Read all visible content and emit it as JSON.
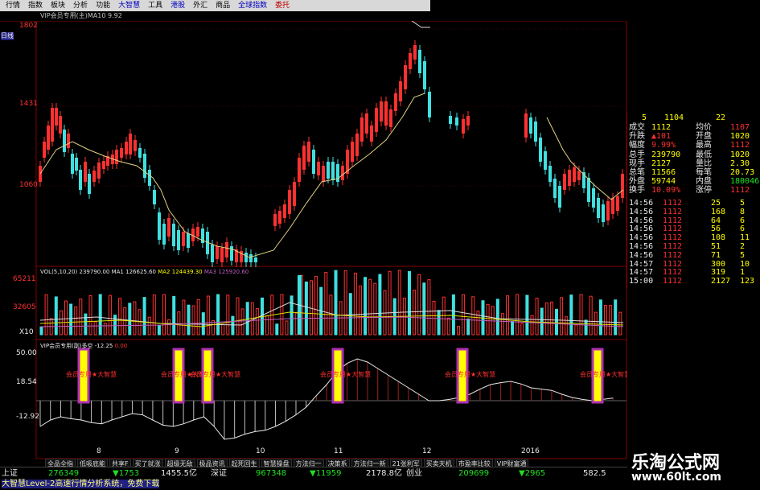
{
  "menu": {
    "items": [
      {
        "label": "行情",
        "color": "black"
      },
      {
        "label": "指数",
        "color": "black"
      },
      {
        "label": "板块",
        "color": "black"
      },
      {
        "label": "分析",
        "color": "black"
      },
      {
        "label": "功能",
        "color": "black"
      },
      {
        "label": "大智慧",
        "color": "blue"
      },
      {
        "label": "工具",
        "color": "black"
      },
      {
        "label": "港股",
        "color": "blue"
      },
      {
        "label": "外汇",
        "color": "black"
      },
      {
        "label": "商品",
        "color": "black"
      },
      {
        "label": "全球指数",
        "color": "blue"
      },
      {
        "label": "委托",
        "color": "red"
      }
    ]
  },
  "chart_header": {
    "indicator_title": "VIP会员专用(主)MA10 9.92",
    "period": "日线"
  },
  "price_axis": {
    "labels": [
      "1802",
      "1431",
      "1060"
    ]
  },
  "volume_header": {
    "vol": "VOL(5,10,20)",
    "vol_value": "239790.00",
    "ma1_label": "MA1",
    "ma1": "126625.60",
    "ma2_label": "MA2",
    "ma2": "124439.30",
    "ma3_label": "MA3",
    "ma3": "125920.60"
  },
  "volume_axis": {
    "labels": [
      "65211",
      "32605"
    ],
    "unit": "X10"
  },
  "osc_header": {
    "title": "VIP会员专用(副)多空",
    "value": "-12.25",
    "value2": "0.00"
  },
  "osc_axis": {
    "labels": [
      "50.00",
      "18.54",
      "-12.92"
    ]
  },
  "x_axis": {
    "labels": [
      "8",
      "9",
      "10",
      "11",
      "12",
      "2016"
    ]
  },
  "signal_label": "会员专用",
  "signal_star": "★",
  "signal_text2": "大智慧",
  "quote": {
    "code": "5",
    "price": "1104",
    "num": "22",
    "fields": [
      {
        "k1": "成交",
        "v1": "1112",
        "k2": "均价",
        "v2": "1107"
      },
      {
        "k1": "升跌",
        "v1": "▲101",
        "k2": "开盘",
        "v2": "1020"
      },
      {
        "k1": "幅度",
        "v1": "9.99%",
        "k2": "最高",
        "v2": "1112"
      },
      {
        "k1": "总手",
        "v1": "239790",
        "k2": "最低",
        "v2": "1020"
      },
      {
        "k1": "现手",
        "v1": "2127",
        "k2": "量比",
        "v2": "2.30"
      },
      {
        "k1": "总笔",
        "v1": "11566",
        "k2": "每笔",
        "v2": "20.73"
      },
      {
        "k1": "外盘",
        "v1": "59744",
        "k2": "内盘",
        "v2": "180046"
      },
      {
        "k1": "换手",
        "v1": "10.09%",
        "k2": "涨停",
        "v2": "1112"
      }
    ],
    "ticks": [
      {
        "t": "14:56",
        "p": "1112",
        "v": "25",
        "n": "5"
      },
      {
        "t": "14:56",
        "p": "1112",
        "v": "168",
        "n": "8"
      },
      {
        "t": "14:56",
        "p": "1112",
        "v": "64",
        "n": "6"
      },
      {
        "t": "14:56",
        "p": "1112",
        "v": "56",
        "n": "6"
      },
      {
        "t": "14:56",
        "p": "1112",
        "v": "108",
        "n": "11"
      },
      {
        "t": "14:56",
        "p": "1112",
        "v": "51",
        "n": "2"
      },
      {
        "t": "14:56",
        "p": "1112",
        "v": "71",
        "n": "5"
      },
      {
        "t": "14:57",
        "p": "1112",
        "v": "300",
        "n": "10"
      },
      {
        "t": "14:57",
        "p": "1112",
        "v": "319",
        "n": "1"
      },
      {
        "t": "15:00",
        "p": "1112",
        "v": "2127",
        "n": "123"
      }
    ]
  },
  "tabs": [
    "全品全指",
    "低吸底能",
    "共享F",
    "买了就涨",
    "超级无敌",
    "极品资讯",
    "起死回生",
    "智慧操盘",
    "方法归一",
    "决策系",
    "方法归一新",
    "21张利军",
    "买卖天机",
    "市盈率比较",
    "VIP财富通"
  ],
  "status": {
    "market1": "上证",
    "v1": "276349",
    "v2": "▼1753",
    "v3": "1455.5亿",
    "market2": "深证",
    "v4": "967348",
    "v5": "▼11959",
    "v6": "2178.8亿",
    "market3": "创业",
    "v7": "209699",
    "v8": "▼2965",
    "v9": "582.5",
    "ticker": "大智慧Level-2高速行情分析系统，免费下载"
  },
  "watermark": {
    "line1": "乐淘公式网",
    "line2": "www.60lt.com"
  },
  "colors": {
    "up": "#ff3030",
    "down": "#40e0e0",
    "ma": "#e0d080",
    "signal": "#ffff00",
    "signal_border": "#b030b0"
  }
}
